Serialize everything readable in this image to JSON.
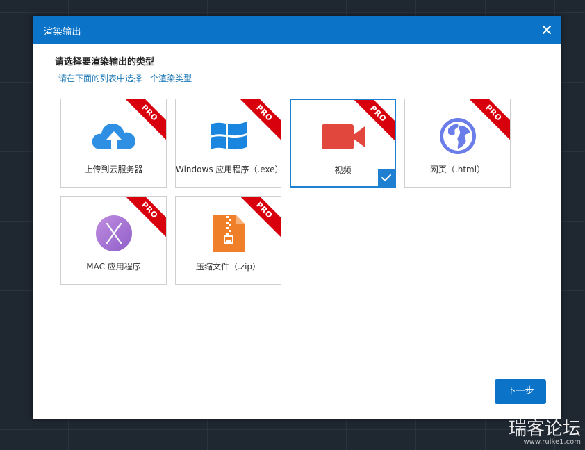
{
  "dialog": {
    "title": "渲染输出",
    "heading": "请选择要渲染输出的类型",
    "subheading": "请在下面的列表中选择一个渲染类型",
    "next_label": "下一步",
    "close_icon": "close-icon"
  },
  "options": [
    {
      "label": "上传到云服务器",
      "badge": "PRO",
      "icon": "cloud-upload-icon",
      "selected": false
    },
    {
      "label": "Windows 应用程序（.exe）",
      "badge": "PRO",
      "icon": "windows-logo-icon",
      "selected": false
    },
    {
      "label": "视频",
      "badge": "PRO",
      "icon": "video-camera-icon",
      "selected": true
    },
    {
      "label": "网页（.html）",
      "badge": "PRO",
      "icon": "globe-icon",
      "selected": false
    },
    {
      "label": "MAC 应用程序",
      "badge": "PRO",
      "icon": "mac-x-icon",
      "selected": false
    },
    {
      "label": "压缩文件（.zip）",
      "badge": "PRO",
      "icon": "zip-file-icon",
      "selected": false
    }
  ],
  "watermark": {
    "text": "瑞客论坛",
    "url": "www.ruike1.com"
  },
  "colors": {
    "accent": "#0b74c9",
    "pro_badge": "#d9000e",
    "selected_border": "#1f7fd0"
  }
}
